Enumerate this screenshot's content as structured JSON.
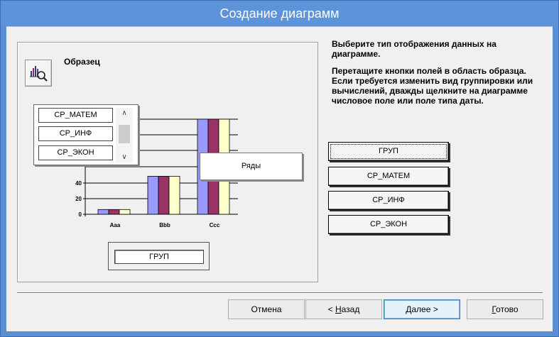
{
  "window": {
    "title": "Создание диаграмм"
  },
  "sample": {
    "title": "Образец",
    "fields": [
      "СР_МАТЕМ",
      "СР_ИНФ",
      "СР_ЭКОН"
    ],
    "series_label": "Ряды",
    "axis_label": "ГРУП"
  },
  "instructions": {
    "p1": "Выберите тип отображения данных на диаграмме.",
    "p2": "Перетащите кнопки полей в область образца. Если требуется изменить вид группировки или вычислений, дважды щелкните на диаграмме числовое поле или поле типа даты."
  },
  "field_buttons": [
    "ГРУП",
    "СР_МАТЕМ",
    "СР_ИНФ",
    "СР_ЭКОН"
  ],
  "buttons": {
    "cancel": "Отмена",
    "back_accel": "Н",
    "back_rest": "азад",
    "back_prefix": "< ",
    "next_accel": "Д",
    "next_rest": "алее >",
    "finish_accel": "Г",
    "finish_rest": "отово"
  },
  "colors": {
    "series1": "#9999ff",
    "series2": "#993366",
    "series3": "#ffffcc"
  },
  "chart_data": {
    "type": "bar",
    "categories": [
      "Aaa",
      "Bbb",
      "Ccc"
    ],
    "series": [
      {
        "values": [
          5,
          40,
          100
        ]
      },
      {
        "values": [
          5,
          40,
          100
        ]
      },
      {
        "values": [
          5,
          40,
          100
        ]
      }
    ],
    "yticks": [
      "0",
      "20",
      "40"
    ],
    "ylim": [
      0,
      100
    ]
  }
}
